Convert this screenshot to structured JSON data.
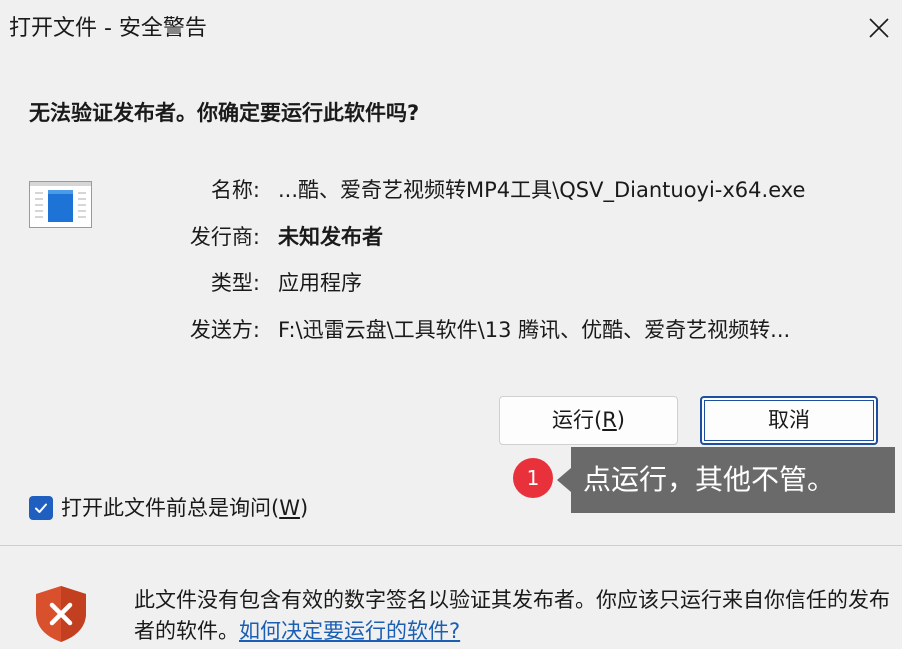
{
  "window": {
    "title": "打开文件 - 安全警告"
  },
  "dialog": {
    "heading": "无法验证发布者。你确定要运行此软件吗?",
    "fields": [
      {
        "label": "名称:",
        "value": "...酷、爱奇艺视频转MP4工具\\QSV_Diantuoyi-x64.exe",
        "bold": false
      },
      {
        "label": "发行商:",
        "value": "未知发布者",
        "bold": true
      },
      {
        "label": "类型:",
        "value": "应用程序",
        "bold": false
      },
      {
        "label": "发送方:",
        "value": "F:\\迅雷云盘\\工具软件\\13 腾讯、优酷、爱奇艺视频转...",
        "bold": false
      }
    ],
    "buttons": {
      "run_label_prefix": "运行(",
      "run_accel": "R",
      "run_label_suffix": ")",
      "cancel_label": "取消"
    },
    "checkbox": {
      "label_prefix": "打开此文件前总是询问(",
      "accel": "W",
      "label_suffix": ")",
      "checked": true
    },
    "warning": {
      "text": "此文件没有包含有效的数字签名以验证其发布者。你应该只运行来自你信任的发布者的软件。",
      "link": "如何决定要运行的软件?"
    }
  },
  "annotation": {
    "badge": "1",
    "tooltip": "点运行，其他不管。"
  },
  "colors": {
    "accent": "#1f5fbf",
    "badge": "#e8313a",
    "tooltip_bg": "#6a6a6a",
    "link": "#1a5fb4",
    "shield": "#d8502c"
  }
}
